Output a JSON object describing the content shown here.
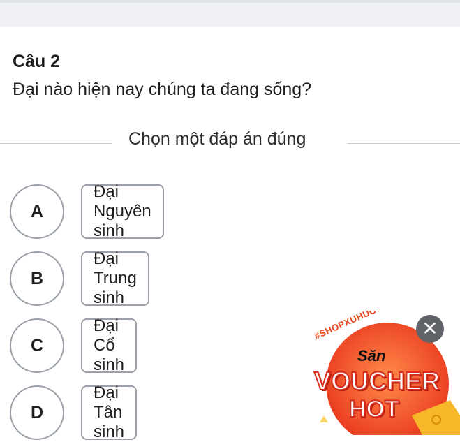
{
  "question": {
    "number": "Câu 2",
    "text": "Đại nào hiện nay chúng ta đang sống?",
    "instruction": "Chọn một đáp án đúng"
  },
  "options": [
    {
      "letter": "A",
      "text": "Đại Nguyên sinh"
    },
    {
      "letter": "B",
      "text": "Đại Trung sinh"
    },
    {
      "letter": "C",
      "text": "Đại Cổ sinh"
    },
    {
      "letter": "D",
      "text": "Đại Tân sinh"
    }
  ],
  "promo": {
    "tag": "#SHOPXUHUONG",
    "san": "Săn",
    "voucher": "VOUCHER",
    "hot": "HOT",
    "close_icon": "close-icon",
    "colors": {
      "badge": "#e8341c",
      "badge_light": "#ff7a3d",
      "coin": "#f6b829"
    }
  }
}
